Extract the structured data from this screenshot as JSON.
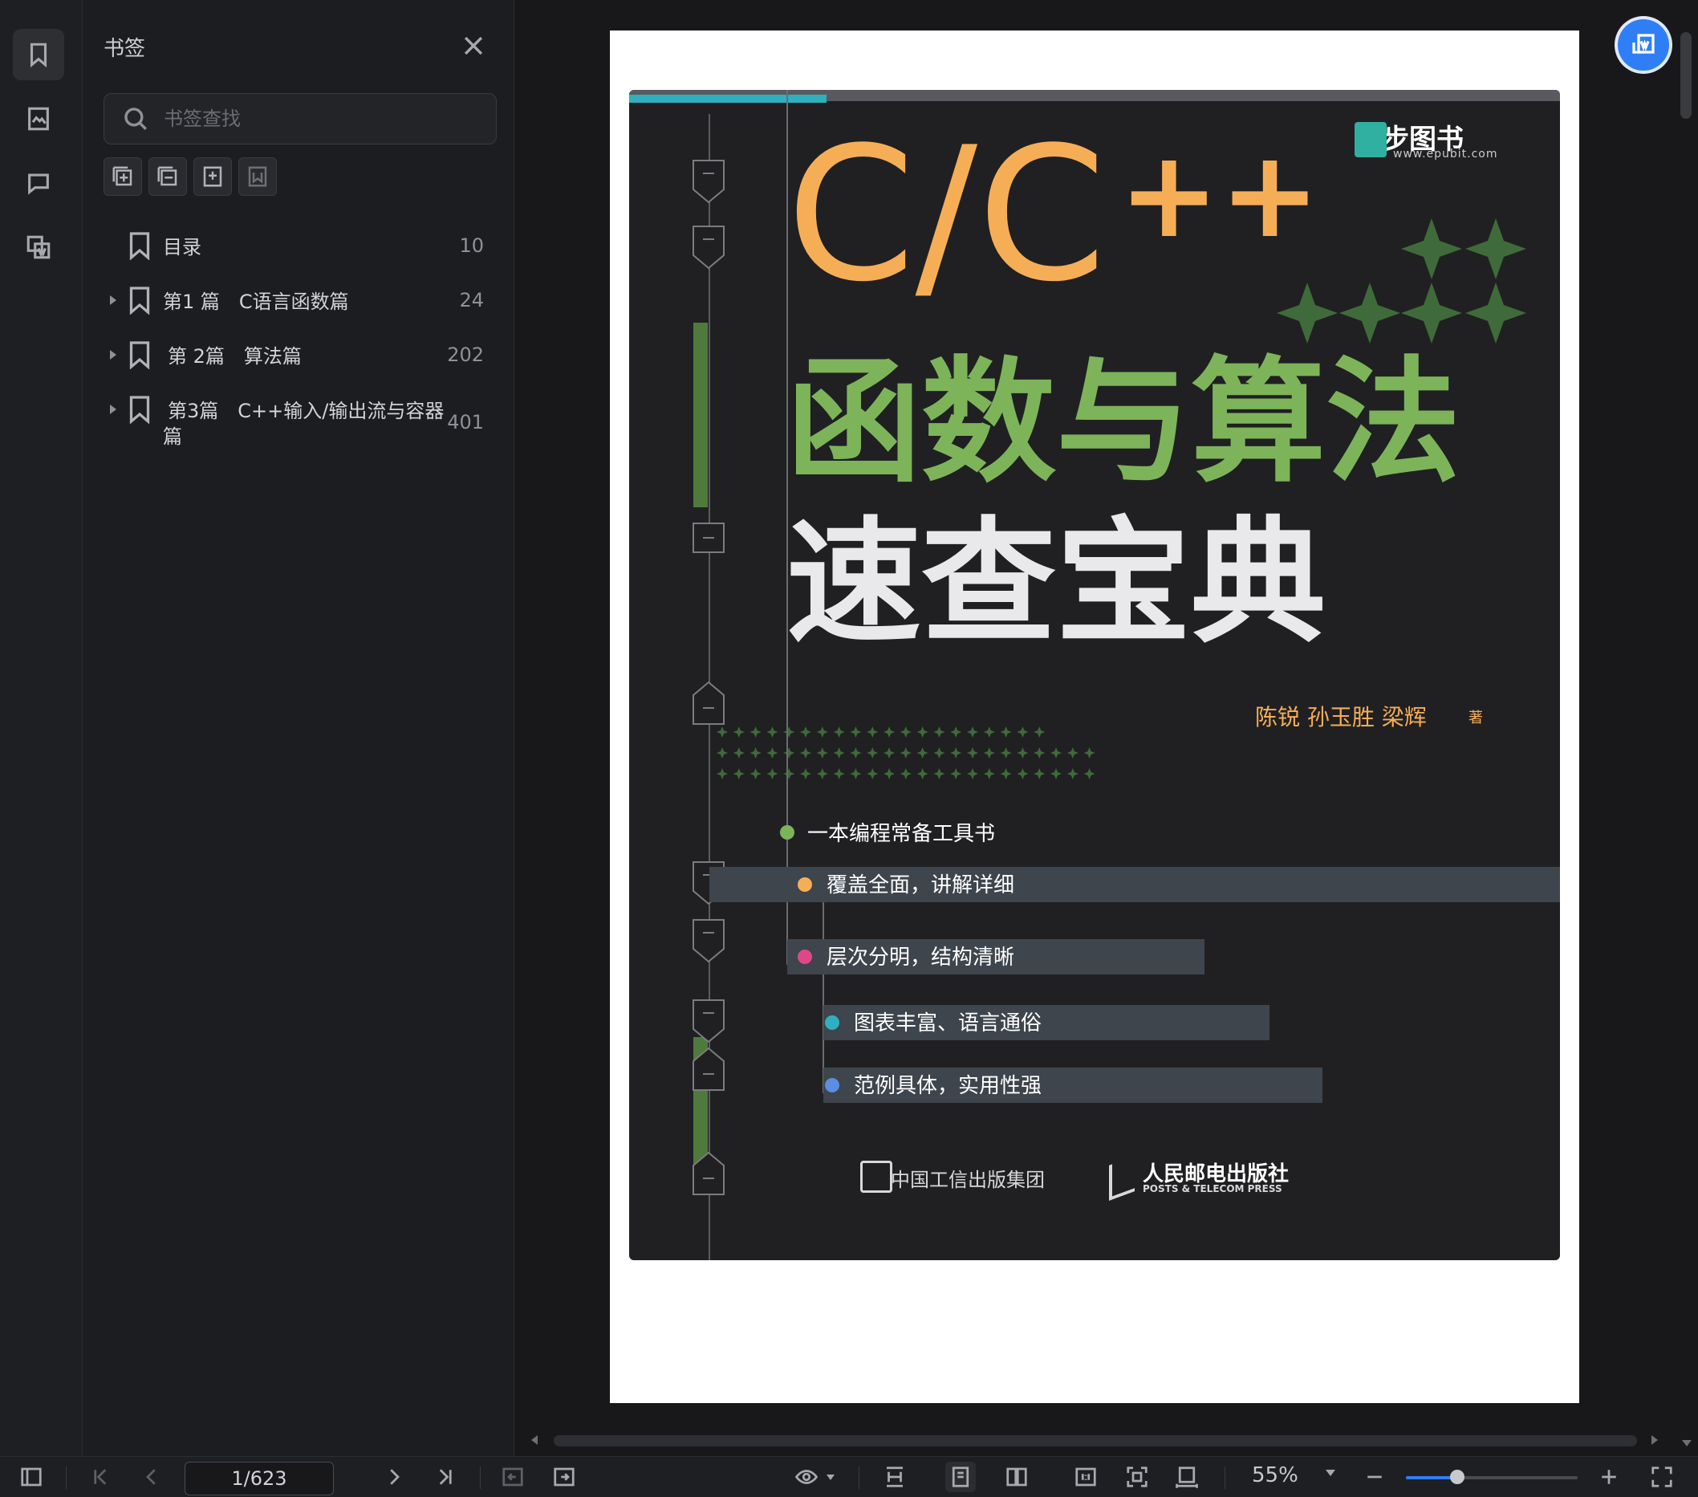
{
  "sidebar_rail": {
    "items": [
      "bookmark-icon",
      "image-icon",
      "comment-icon",
      "attachment-icon"
    ]
  },
  "bookmarks_panel": {
    "title": "书签",
    "search_placeholder": "书签查找",
    "items": [
      {
        "label": "目录",
        "page": "10",
        "expandable": false
      },
      {
        "label": "第1 篇　C语言函数篇",
        "page": "24",
        "expandable": true
      },
      {
        "label": "第 2篇　算法篇",
        "page": "202",
        "expandable": true
      },
      {
        "label_line1": "第3篇　C++输入/输出流与容器",
        "label_line2": "篇",
        "page": "401",
        "expandable": true
      }
    ]
  },
  "toolbar": {
    "page_value": "1/623",
    "zoom": "55%",
    "zoom_fraction": 0.3
  },
  "cover": {
    "publisher_logo": "异步图书",
    "publisher_url": "www.epubit.com",
    "title_cc": "C/C",
    "title_pp": "++",
    "title_line1": "函数与算法",
    "title_line2": "速查宝典",
    "authors": "陈锐  孙玉胜  梁辉",
    "authors_suffix": "著",
    "features": [
      "一本编程常备工具书",
      "覆盖全面，讲解详细",
      "层次分明，结构清晰",
      "图表丰富、语言通俗",
      "范例具体，实用性强"
    ],
    "publisher1": "中国工信出版集团",
    "publisher2": "人民邮电出版社",
    "publisher2_en": "POSTS & TELECOM PRESS",
    "colors": {
      "orange": "#f6ae56",
      "green": "#7db45a",
      "pink": "#e0478a",
      "teal": "#2fb0c0",
      "blue": "#5b8ee0"
    }
  }
}
